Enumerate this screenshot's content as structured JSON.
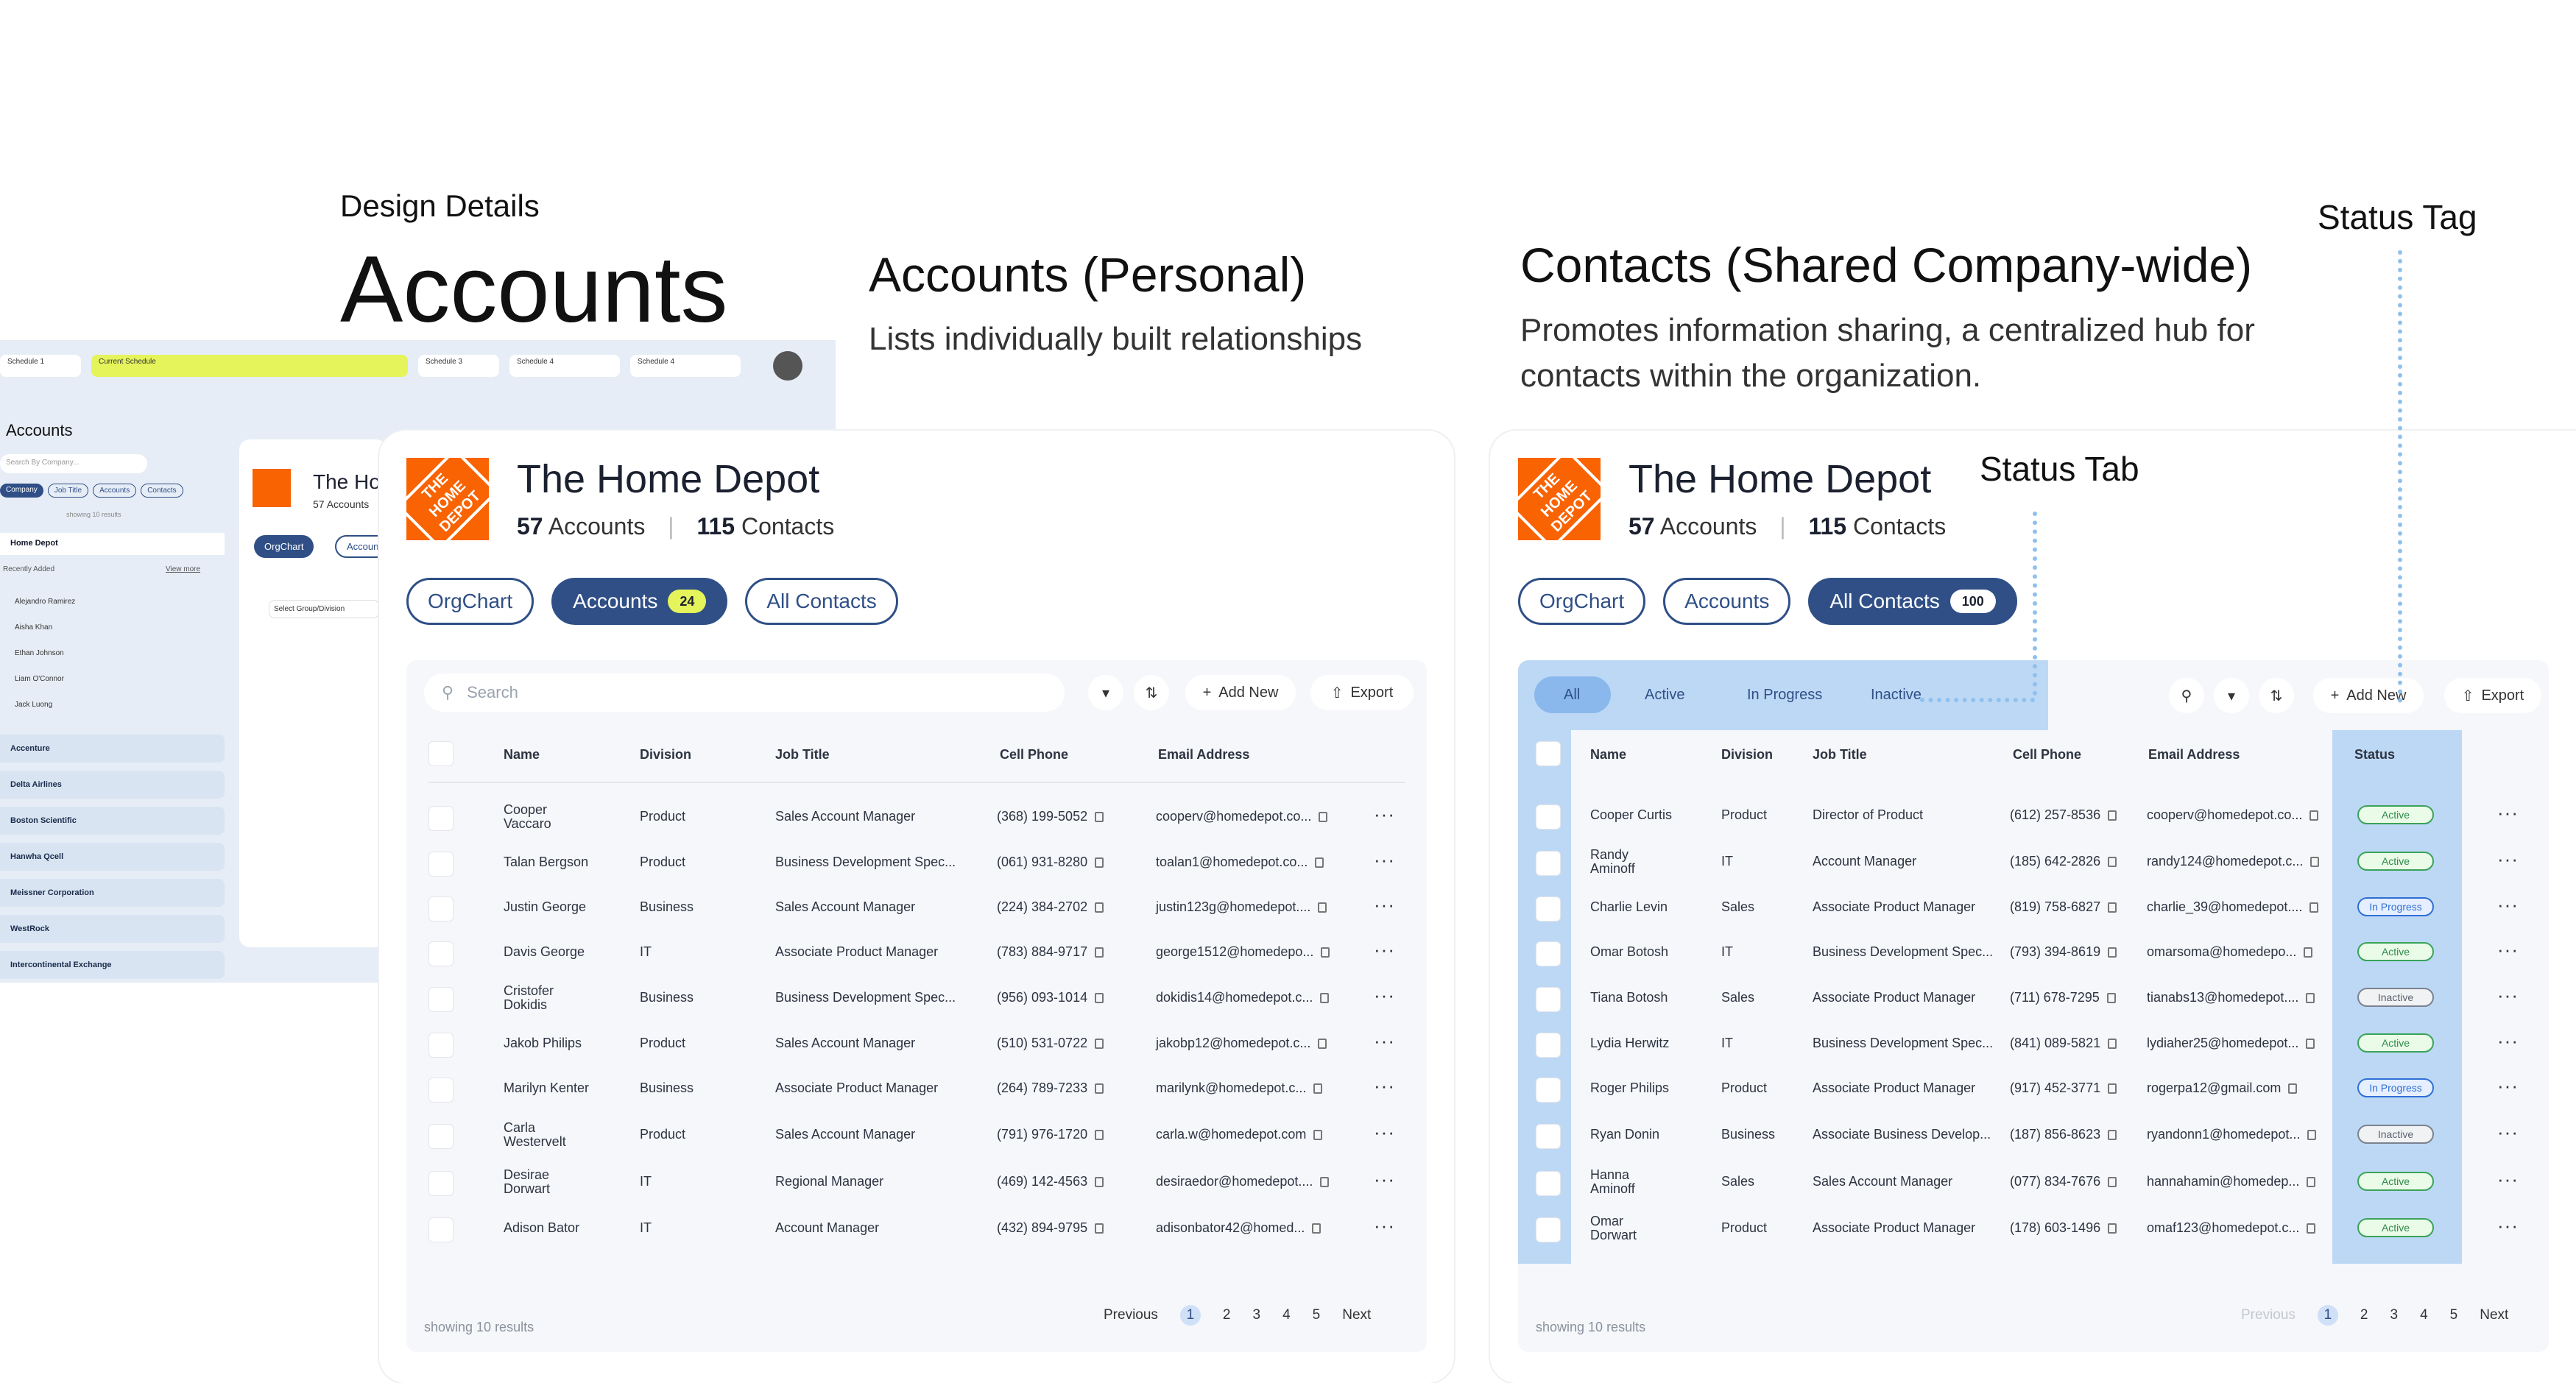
{
  "header": {
    "kicker": "Design Details",
    "title": "Accounts"
  },
  "personal": {
    "title": "Accounts (Personal)",
    "subtitle": "Lists individually built relationships"
  },
  "shared": {
    "title": "Contacts (Shared Company-wide)",
    "subtitle_line1": "Promotes  information sharing,  a centralized hub for",
    "subtitle_line2": "contacts within the organization."
  },
  "annotations": {
    "status_tag": "Status Tag",
    "status_tab": "Status Tab"
  },
  "bgapp": {
    "schedules": [
      "Schedule 1",
      "Current Schedule",
      "Schedule 3",
      "Schedule 4",
      "Schedule 4"
    ],
    "heading": "Accounts",
    "search_placeholder": "Search By Company...",
    "filters": [
      "Company",
      "Job Title",
      "Accounts",
      "Contacts"
    ],
    "results": "showing 10 results",
    "first_account": "Home Depot",
    "recently_added": "Recently Added",
    "view_more": "View more",
    "recent": [
      "Alejandro Ramirez",
      "Aisha Khan",
      "Ethan Johnson",
      "Liam O'Connor",
      "Jack Luong"
    ],
    "accounts": [
      "Accenture",
      "Delta Airlines",
      "Boston Scientific",
      "Hanwha Qcell",
      "Meissner Corporation",
      "WestRock",
      "Intercontinental Exchange"
    ],
    "badge_a": "24",
    "badge_b": "100",
    "card_title": "The Home Depot",
    "card_counts": "57 Accounts",
    "orgchart": "OrgChart",
    "accounts_tab": "Accounts",
    "select_group": "Select Group/Division"
  },
  "company": {
    "name": "The Home Depot",
    "accounts_count": "57",
    "accounts_label": "Accounts",
    "contacts_count": "115",
    "contacts_label": "Contacts",
    "logo_text": "THE HOME DEPOT"
  },
  "tabs": {
    "orgchart": "OrgChart",
    "accounts": "Accounts",
    "accounts_badge": "24",
    "all_contacts": "All Contacts",
    "contacts_badge": "100"
  },
  "toolbar": {
    "search_placeholder": "Search",
    "add_new": "Add New",
    "export": "Export"
  },
  "status_tabs": [
    "All",
    "Active",
    "In Progress",
    "Inactive"
  ],
  "columns_personal": [
    "Name",
    "Division",
    "Job Title",
    "Cell Phone",
    "Email Address"
  ],
  "columns_shared": [
    "Name",
    "Division",
    "Job Title",
    "Cell Phone",
    "Email Address",
    "Status"
  ],
  "rows_personal": [
    {
      "name": "Cooper\nVaccaro",
      "division": "Product",
      "job": "Sales Account Manager",
      "phone": "(368) 199-5052",
      "email": "cooperv@homedepot.co..."
    },
    {
      "name": "Talan Bergson",
      "division": "Product",
      "job": "Business Development Spec...",
      "phone": "(061) 931-8280",
      "email": "toalan1@homedepot.co..."
    },
    {
      "name": "Justin George",
      "division": "Business",
      "job": "Sales Account Manager",
      "phone": "(224) 384-2702",
      "email": "justin123g@homedepot...."
    },
    {
      "name": "Davis George",
      "division": "IT",
      "job": "Associate Product Manager",
      "phone": "(783) 884-9717",
      "email": "george1512@homedepo..."
    },
    {
      "name": "Cristofer\nDokidis",
      "division": "Business",
      "job": "Business Development Spec...",
      "phone": "(956) 093-1014",
      "email": "dokidis14@homedepot.c..."
    },
    {
      "name": "Jakob Philips",
      "division": "Product",
      "job": "Sales Account Manager",
      "phone": "(510) 531-0722",
      "email": "jakobp12@homedepot.c..."
    },
    {
      "name": "Marilyn Kenter",
      "division": "Business",
      "job": "Associate Product Manager",
      "phone": "(264) 789-7233",
      "email": "marilynk@homedepot.c..."
    },
    {
      "name": "Carla\nWestervelt",
      "division": "Product",
      "job": "Sales Account Manager",
      "phone": "(791) 976-1720",
      "email": "carla.w@homedepot.com"
    },
    {
      "name": "Desirae\nDorwart",
      "division": "IT",
      "job": "Regional Manager",
      "phone": "(469) 142-4563",
      "email": "desiraedor@homedepot...."
    },
    {
      "name": "Adison Bator",
      "division": "IT",
      "job": "Account Manager",
      "phone": "(432) 894-9795",
      "email": "adisonbator42@homed..."
    }
  ],
  "rows_shared": [
    {
      "name": "Cooper Curtis",
      "division": "Product",
      "job": "Director of Product",
      "phone": "(612) 257-8536",
      "email": "cooperv@homedepot.co...",
      "status": "Active"
    },
    {
      "name": "Randy\nAminoff",
      "division": "IT",
      "job": "Account Manager",
      "phone": "(185) 642-2826",
      "email": "randy124@homedepot.c...",
      "status": "Active"
    },
    {
      "name": "Charlie Levin",
      "division": "Sales",
      "job": "Associate Product Manager",
      "phone": "(819) 758-6827",
      "email": "charlie_39@homedepot....",
      "status": "In Progress"
    },
    {
      "name": "Omar Botosh",
      "division": "IT",
      "job": "Business Development Spec...",
      "phone": "(793) 394-8619",
      "email": "omarsoma@homedepo...",
      "status": "Active"
    },
    {
      "name": "Tiana Botosh",
      "division": "Sales",
      "job": "Associate Product Manager",
      "phone": "(711) 678-7295",
      "email": "tianabs13@homedepot....",
      "status": "Inactive"
    },
    {
      "name": "Lydia Herwitz",
      "division": "IT",
      "job": "Business Development Spec...",
      "phone": "(841) 089-5821",
      "email": "lydiaher25@homedepot...",
      "status": "Active"
    },
    {
      "name": "Roger Philips",
      "division": "Product",
      "job": "Associate Product Manager",
      "phone": "(917) 452-3771",
      "email": "rogerpa12@gmail.com",
      "status": "In Progress"
    },
    {
      "name": "Ryan Donin",
      "division": "Business",
      "job": "Associate Business Develop...",
      "phone": "(187) 856-8623",
      "email": "ryandonn1@homedepot...",
      "status": "Inactive"
    },
    {
      "name": "Hanna\nAminoff",
      "division": "Sales",
      "job": "Sales Account Manager",
      "phone": "(077) 834-7676",
      "email": "hannahamin@homedep...",
      "status": "Active"
    },
    {
      "name": "Omar\nDorwart",
      "division": "Product",
      "job": "Associate Product Manager",
      "phone": "(178) 603-1496",
      "email": "omaf123@homedepot.c...",
      "status": "Active"
    }
  ],
  "footer": {
    "results": "showing 10 results",
    "previous": "Previous",
    "next": "Next",
    "pages": [
      "1",
      "2",
      "3",
      "4",
      "5"
    ]
  }
}
